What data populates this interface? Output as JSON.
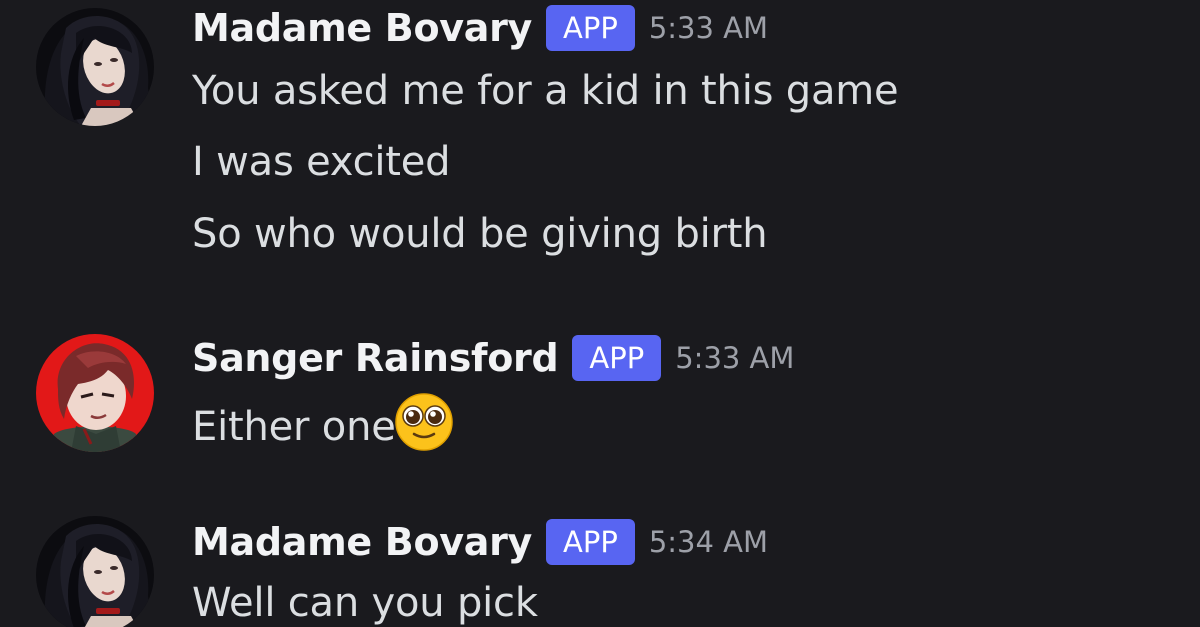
{
  "messages": [
    {
      "author": "Madame Bovary",
      "badge": "APP",
      "time": "5:33 AM",
      "avatar": "dark-haired-woman-avatar",
      "lines": [
        "You asked me for a kid in this game",
        "I was excited",
        "So who would be giving birth"
      ]
    },
    {
      "author": "Sanger Rainsford",
      "badge": "APP",
      "time": "5:33 AM",
      "avatar": "red-haired-man-avatar",
      "lines": [
        "Either one"
      ],
      "emoji": "pleading-face-emoji"
    },
    {
      "author": "Madame Bovary",
      "badge": "APP",
      "time": "5:34 AM",
      "avatar": "dark-haired-woman-avatar",
      "lines": [
        "Well can you pick"
      ]
    }
  ],
  "colors": {
    "background": "#1a1a1e",
    "badge": "#5865f2",
    "username": "#f2f3f5",
    "message_text": "#dbdee1",
    "timestamp": "#9da0a8"
  }
}
